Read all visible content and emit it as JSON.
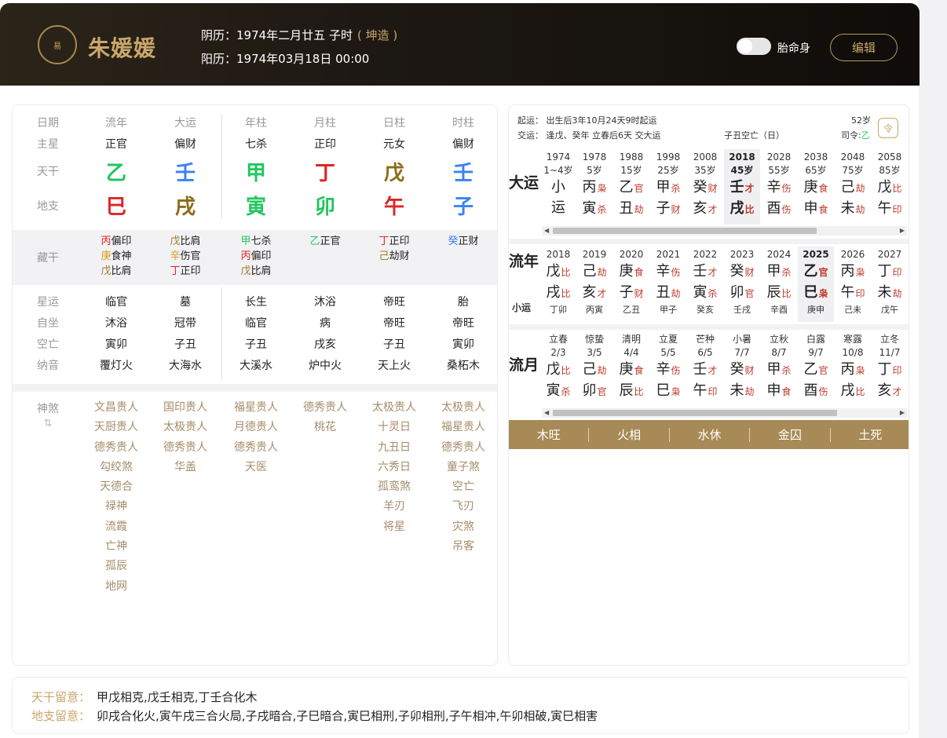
{
  "header": {
    "name": "朱媛媛",
    "lunar": "阴历：1974年二月廿五 子时",
    "zao": "( 坤造 )",
    "solar": "阳历：1974年03月18日 00:00",
    "toggle_label": "胎命身",
    "edit_label": "编辑",
    "logo_text": "易"
  },
  "pillars": {
    "row_labels": [
      "日期",
      "主星",
      "天干",
      "地支",
      "藏干",
      "星运",
      "自坐",
      "空亡",
      "纳音",
      "神煞"
    ],
    "headers": [
      "流年",
      "大运",
      "年柱",
      "月柱",
      "日柱",
      "时柱"
    ],
    "zhuxing": [
      "正官",
      "偏财",
      "七杀",
      "正印",
      "元女",
      "偏财"
    ],
    "tiangan": [
      "乙",
      "壬",
      "甲",
      "丁",
      "戊",
      "壬"
    ],
    "tiangan_colors": [
      "#22c55e",
      "#3b82f6",
      "#22c55e",
      "#dc2626",
      "#8a6d1c",
      "#3b82f6"
    ],
    "dizhi": [
      "巳",
      "戌",
      "寅",
      "卯",
      "午",
      "子"
    ],
    "dizhi_colors": [
      "#dc2626",
      "#8a6d1c",
      "#22c55e",
      "#22c55e",
      "#dc2626",
      "#3b82f6"
    ],
    "canggan": [
      [
        {
          "g": "丙",
          "c": "#dc2626",
          "t": "偏印"
        },
        {
          "g": "庚",
          "c": "#d4a017",
          "t": "食神"
        },
        {
          "g": "戊",
          "c": "#a0782a",
          "t": "比肩"
        }
      ],
      [
        {
          "g": "戊",
          "c": "#a0782a",
          "t": "比肩"
        },
        {
          "g": "辛",
          "c": "#d4a017",
          "t": "伤官"
        },
        {
          "g": "丁",
          "c": "#dc2626",
          "t": "正印"
        }
      ],
      [
        {
          "g": "甲",
          "c": "#22c55e",
          "t": "七杀"
        },
        {
          "g": "丙",
          "c": "#dc2626",
          "t": "偏印"
        },
        {
          "g": "戊",
          "c": "#a0782a",
          "t": "比肩"
        }
      ],
      [
        {
          "g": "乙",
          "c": "#22c55e",
          "t": "正官"
        }
      ],
      [
        {
          "g": "丁",
          "c": "#dc2626",
          "t": "正印"
        },
        {
          "g": "己",
          "c": "#a0782a",
          "t": "劫财"
        }
      ],
      [
        {
          "g": "癸",
          "c": "#3b82f6",
          "t": "正财"
        }
      ]
    ],
    "xingyun": [
      "临官",
      "墓",
      "长生",
      "沐浴",
      "帝旺",
      "胎"
    ],
    "zizuo": [
      "沐浴",
      "冠带",
      "临官",
      "病",
      "帝旺",
      "帝旺"
    ],
    "kongwang": [
      "寅卯",
      "子丑",
      "子丑",
      "戌亥",
      "子丑",
      "寅卯"
    ],
    "nayin": [
      "覆灯火",
      "大海水",
      "大溪水",
      "炉中火",
      "天上火",
      "桑柘木"
    ],
    "shensha_icon": "sort-icon",
    "shensha": [
      [
        "文昌贵人",
        "天厨贵人",
        "德秀贵人",
        "勾绞煞",
        "天德合",
        "禄神",
        "流霞",
        "亡神",
        "孤辰",
        "地网"
      ],
      [
        "国印贵人",
        "太极贵人",
        "德秀贵人",
        "华盖"
      ],
      [
        "福星贵人",
        "月德贵人",
        "德秀贵人",
        "天医"
      ],
      [
        "德秀贵人",
        "桃花"
      ],
      [
        "太极贵人",
        "十灵日",
        "九丑日",
        "六秀日",
        "孤鸾煞",
        "羊刃",
        "将星"
      ],
      [
        "太极贵人",
        "福星贵人",
        "德秀贵人",
        "童子煞",
        "空亡",
        "飞刃",
        "灾煞",
        "吊客"
      ]
    ]
  },
  "luck": {
    "qiyun": "起运： 出生后3年10月24天9时起运",
    "jiaoyun": "交运： 逢戊、癸年 立春后6天 交大运",
    "kongwang": "子丑空亡（日）",
    "age": "52岁",
    "siling_label": "司令:",
    "siling_gan": "乙",
    "dayun_label": "大运",
    "dayun": [
      {
        "y": "1974",
        "a": "1~4岁",
        "g1": "小",
        "s1": "",
        "g2": "运",
        "s2": ""
      },
      {
        "y": "1978",
        "a": "5岁",
        "g1": "丙",
        "s1": "枭",
        "g2": "寅",
        "s2": "杀"
      },
      {
        "y": "1988",
        "a": "15岁",
        "g1": "乙",
        "s1": "官",
        "g2": "丑",
        "s2": "劫"
      },
      {
        "y": "1998",
        "a": "25岁",
        "g1": "甲",
        "s1": "杀",
        "g2": "子",
        "s2": "财"
      },
      {
        "y": "2008",
        "a": "35岁",
        "g1": "癸",
        "s1": "财",
        "g2": "亥",
        "s2": "才"
      },
      {
        "y": "2018",
        "a": "45岁",
        "g1": "壬",
        "s1": "才",
        "g2": "戌",
        "s2": "比",
        "cur": true
      },
      {
        "y": "2028",
        "a": "55岁",
        "g1": "辛",
        "s1": "伤",
        "g2": "酉",
        "s2": "伤"
      },
      {
        "y": "2038",
        "a": "65岁",
        "g1": "庚",
        "s1": "食",
        "g2": "申",
        "s2": "食"
      },
      {
        "y": "2048",
        "a": "75岁",
        "g1": "己",
        "s1": "劫",
        "g2": "未",
        "s2": "劫"
      },
      {
        "y": "2058",
        "a": "85岁",
        "g1": "戊",
        "s1": "比",
        "g2": "午",
        "s2": "印"
      }
    ],
    "liunian_label": "流年",
    "xiaoyun_label": "小运",
    "liunian": [
      {
        "y": "2018",
        "g1": "戊",
        "s1": "比",
        "g2": "戌",
        "s2": "比",
        "x": "丁卯"
      },
      {
        "y": "2019",
        "g1": "己",
        "s1": "劫",
        "g2": "亥",
        "s2": "才",
        "x": "丙寅"
      },
      {
        "y": "2020",
        "g1": "庚",
        "s1": "食",
        "g2": "子",
        "s2": "财",
        "x": "乙丑"
      },
      {
        "y": "2021",
        "g1": "辛",
        "s1": "伤",
        "g2": "丑",
        "s2": "劫",
        "x": "甲子"
      },
      {
        "y": "2022",
        "g1": "壬",
        "s1": "才",
        "g2": "寅",
        "s2": "杀",
        "x": "癸亥"
      },
      {
        "y": "2023",
        "g1": "癸",
        "s1": "财",
        "g2": "卯",
        "s2": "官",
        "x": "壬戌"
      },
      {
        "y": "2024",
        "g1": "甲",
        "s1": "杀",
        "g2": "辰",
        "s2": "比",
        "x": "辛酉"
      },
      {
        "y": "2025",
        "g1": "乙",
        "s1": "官",
        "g2": "巳",
        "s2": "枭",
        "x": "庚申",
        "cur": true
      },
      {
        "y": "2026",
        "g1": "丙",
        "s1": "枭",
        "g2": "午",
        "s2": "印",
        "x": "己未"
      },
      {
        "y": "2027",
        "g1": "丁",
        "s1": "印",
        "g2": "未",
        "s2": "劫",
        "x": "戊午"
      }
    ],
    "liuyue_label": "流月",
    "liuyue": [
      {
        "t": "立春",
        "d": "2/3",
        "g1": "戊",
        "s1": "比",
        "g2": "寅",
        "s2": "杀"
      },
      {
        "t": "惊蛰",
        "d": "3/5",
        "g1": "己",
        "s1": "劫",
        "g2": "卯",
        "s2": "官"
      },
      {
        "t": "清明",
        "d": "4/4",
        "g1": "庚",
        "s1": "食",
        "g2": "辰",
        "s2": "比"
      },
      {
        "t": "立夏",
        "d": "5/5",
        "g1": "辛",
        "s1": "伤",
        "g2": "巳",
        "s2": "枭"
      },
      {
        "t": "芒种",
        "d": "6/5",
        "g1": "壬",
        "s1": "才",
        "g2": "午",
        "s2": "印"
      },
      {
        "t": "小暑",
        "d": "7/7",
        "g1": "癸",
        "s1": "财",
        "g2": "未",
        "s2": "劫"
      },
      {
        "t": "立秋",
        "d": "8/7",
        "g1": "甲",
        "s1": "杀",
        "g2": "申",
        "s2": "食"
      },
      {
        "t": "白露",
        "d": "9/7",
        "g1": "乙",
        "s1": "官",
        "g2": "酉",
        "s2": "伤"
      },
      {
        "t": "寒露",
        "d": "10/8",
        "g1": "丙",
        "s1": "枭",
        "g2": "戌",
        "s2": "比"
      },
      {
        "t": "立冬",
        "d": "11/7",
        "g1": "丁",
        "s1": "印",
        "g2": "亥",
        "s2": "才"
      }
    ],
    "wuxing": [
      "木旺",
      "火相",
      "水休",
      "金囚",
      "土死"
    ]
  },
  "notes": {
    "tiangan_label": "天干留意：",
    "tiangan": "甲戊相克,戊壬相克,丁壬合化木",
    "dizhi_label": "地支留意：",
    "dizhi": "卯戌合化火,寅午戌三合火局,子戌暗合,子巳暗合,寅巳相刑,子卯相刑,子午相冲,午卯相破,寅巳相害"
  }
}
